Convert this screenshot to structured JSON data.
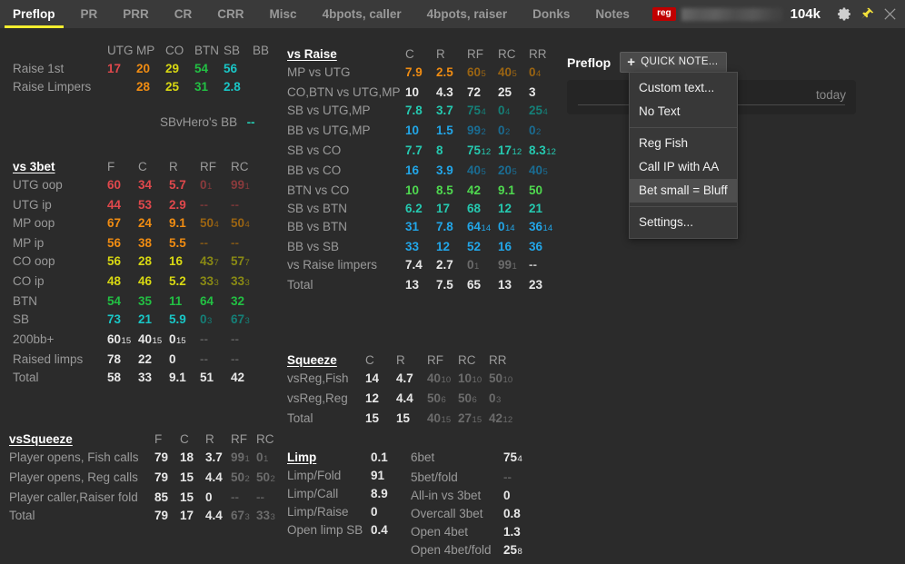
{
  "topbar": {
    "tabs": [
      {
        "label": "Preflop",
        "active": true
      },
      {
        "label": "PR",
        "active": false
      },
      {
        "label": "PRR",
        "active": false
      },
      {
        "label": "CR",
        "active": false
      },
      {
        "label": "CRR",
        "active": false
      },
      {
        "label": "Misc",
        "active": false
      },
      {
        "label": "4bpots, caller",
        "active": false
      },
      {
        "label": "4bpots, raiser",
        "active": false
      },
      {
        "label": "Donks",
        "active": false
      },
      {
        "label": "Notes",
        "active": false
      }
    ],
    "player_badge": "reg",
    "player_name_hidden": "",
    "stack": "104k",
    "gear_icon": "gear-icon",
    "pin_icon": "pin-icon",
    "close_icon": "close-icon",
    "accent": "#f5ee2e",
    "badge_color": "#c00000"
  },
  "raise_first": {
    "headers": [
      "UTG",
      "MP",
      "CO",
      "BTN",
      "SB",
      "BB"
    ],
    "rows": [
      {
        "label": "Raise 1st",
        "values": [
          "17",
          "20",
          "29",
          "54",
          "56",
          ""
        ]
      },
      {
        "label": "Raise Limpers",
        "values": [
          "",
          "28",
          "25",
          "31",
          "2.8",
          ""
        ]
      }
    ],
    "sb_vs_hero": {
      "label": "SBvHero's BB",
      "value": "--"
    }
  },
  "vs3bet": {
    "title": "vs 3bet",
    "headers": [
      "F",
      "C",
      "R",
      "RF",
      "RC"
    ],
    "rows": [
      {
        "label": "UTG oop",
        "values": [
          "60",
          "34",
          "5.7",
          "0",
          "99"
        ],
        "subs": [
          "",
          "",
          "",
          "1",
          "1"
        ]
      },
      {
        "label": "UTG ip",
        "values": [
          "44",
          "53",
          "2.9",
          "--",
          "--"
        ],
        "subs": [
          "",
          "",
          "",
          "",
          ""
        ]
      },
      {
        "label": "MP oop",
        "values": [
          "67",
          "24",
          "9.1",
          "50",
          "50"
        ],
        "subs": [
          "",
          "",
          "",
          "4",
          "4"
        ]
      },
      {
        "label": "MP ip",
        "values": [
          "56",
          "38",
          "5.5",
          "--",
          "--"
        ],
        "subs": [
          "",
          "",
          "",
          "",
          ""
        ]
      },
      {
        "label": "CO oop",
        "values": [
          "56",
          "28",
          "16",
          "43",
          "57"
        ],
        "subs": [
          "",
          "",
          "",
          "7",
          "7"
        ]
      },
      {
        "label": "CO ip",
        "values": [
          "48",
          "46",
          "5.2",
          "33",
          "33"
        ],
        "subs": [
          "",
          "",
          "",
          "3",
          "3"
        ]
      },
      {
        "label": "BTN",
        "values": [
          "54",
          "35",
          "11",
          "64",
          "32"
        ],
        "subs": [
          "",
          "",
          "",
          "",
          ""
        ]
      },
      {
        "label": "SB",
        "values": [
          "73",
          "21",
          "5.9",
          "0",
          "67"
        ],
        "subs": [
          "",
          "",
          "",
          "3",
          "3"
        ]
      },
      {
        "label": "200bb+",
        "values": [
          "60",
          "40",
          "0",
          "--",
          "--"
        ],
        "subs": [
          "15",
          "15",
          "15",
          "",
          ""
        ]
      },
      {
        "label": "Raised limps",
        "values": [
          "78",
          "22",
          "0",
          "--",
          "--"
        ],
        "subs": [
          "",
          "",
          "",
          "",
          ""
        ]
      },
      {
        "label": "Total",
        "values": [
          "58",
          "33",
          "9.1",
          "51",
          "42"
        ],
        "subs": [
          "",
          "",
          "",
          "",
          ""
        ]
      }
    ]
  },
  "vssqueeze": {
    "title": "vsSqueeze",
    "headers": [
      "F",
      "C",
      "R",
      "RF",
      "RC"
    ],
    "rows": [
      {
        "label": "Player opens, Fish calls",
        "values": [
          "79",
          "18",
          "3.7",
          "99",
          "0"
        ],
        "subs": [
          "",
          "",
          "",
          "1",
          "1"
        ]
      },
      {
        "label": "Player opens, Reg calls",
        "values": [
          "79",
          "15",
          "4.4",
          "50",
          "50"
        ],
        "subs": [
          "",
          "",
          "",
          "2",
          "2"
        ]
      },
      {
        "label": "Player caller,Raiser fold",
        "values": [
          "85",
          "15",
          "0",
          "--",
          "--"
        ],
        "subs": [
          "",
          "",
          "",
          "",
          ""
        ]
      },
      {
        "label": "Total",
        "values": [
          "79",
          "17",
          "4.4",
          "67",
          "33"
        ],
        "subs": [
          "",
          "",
          "",
          "3",
          "3"
        ]
      }
    ]
  },
  "vsraise": {
    "title": "vs Raise",
    "headers": [
      "C",
      "R",
      "RF",
      "RC",
      "RR"
    ],
    "rows": [
      {
        "label": "MP vs UTG",
        "values": [
          "7.9",
          "2.5",
          "60",
          "40",
          "0"
        ],
        "subs": [
          "",
          "",
          "5",
          "5",
          "4"
        ]
      },
      {
        "label": "CO,BTN vs UTG,MP",
        "values": [
          "10",
          "4.3",
          "72",
          "25",
          "3"
        ],
        "subs": [
          "",
          "",
          "",
          "",
          ""
        ]
      },
      {
        "label": "SB vs UTG,MP",
        "values": [
          "7.8",
          "3.7",
          "75",
          "0",
          "25"
        ],
        "subs": [
          "",
          "",
          "4",
          "4",
          "4"
        ]
      },
      {
        "label": "BB vs UTG,MP",
        "values": [
          "10",
          "1.5",
          "99",
          "0",
          "0"
        ],
        "subs": [
          "",
          "",
          "2",
          "2",
          "2"
        ]
      },
      {
        "label": "SB vs CO",
        "values": [
          "7.7",
          "8",
          "75",
          "17",
          "8.3"
        ],
        "subs": [
          "",
          "",
          "12",
          "12",
          "12"
        ]
      },
      {
        "label": "BB vs CO",
        "values": [
          "16",
          "3.9",
          "40",
          "20",
          "40"
        ],
        "subs": [
          "",
          "",
          "5",
          "5",
          "5"
        ]
      },
      {
        "label": "BTN vs CO",
        "values": [
          "10",
          "8.5",
          "42",
          "9.1",
          "50"
        ],
        "subs": [
          "",
          "",
          "",
          "",
          ""
        ]
      },
      {
        "label": "SB vs BTN",
        "values": [
          "6.2",
          "17",
          "68",
          "12",
          "21"
        ],
        "subs": [
          "",
          "",
          "",
          "",
          ""
        ]
      },
      {
        "label": "BB vs BTN",
        "values": [
          "31",
          "7.8",
          "64",
          "0",
          "36"
        ],
        "subs": [
          "",
          "",
          "14",
          "14",
          "14"
        ]
      },
      {
        "label": "BB vs SB",
        "values": [
          "33",
          "12",
          "52",
          "16",
          "36"
        ],
        "subs": [
          "",
          "",
          "",
          "",
          ""
        ]
      },
      {
        "label": "vs Raise limpers",
        "values": [
          "7.4",
          "2.7",
          "0",
          "99",
          "--"
        ],
        "subs": [
          "",
          "",
          "1",
          "1",
          ""
        ]
      },
      {
        "label": "Total",
        "values": [
          "13",
          "7.5",
          "65",
          "13",
          "23"
        ],
        "subs": [
          "",
          "",
          "",
          "",
          ""
        ]
      }
    ]
  },
  "squeeze": {
    "title": "Squeeze",
    "headers": [
      "C",
      "R",
      "RF",
      "RC",
      "RR"
    ],
    "rows": [
      {
        "label": "vsReg,Fish",
        "values": [
          "14",
          "4.7",
          "40",
          "10",
          "50"
        ],
        "subs": [
          "",
          "",
          "10",
          "10",
          "10"
        ]
      },
      {
        "label": "vsReg,Reg",
        "values": [
          "12",
          "4.4",
          "50",
          "50",
          "0"
        ],
        "subs": [
          "",
          "",
          "6",
          "6",
          "3"
        ]
      },
      {
        "label": "Total",
        "values": [
          "15",
          "15",
          "40",
          "27",
          "42"
        ],
        "subs": [
          "",
          "",
          "15",
          "15",
          "12"
        ]
      }
    ]
  },
  "limp": {
    "title": "Limp",
    "title_value": "0.1",
    "rows": [
      {
        "label": "Limp/Fold",
        "value": "91",
        "sub": ""
      },
      {
        "label": "Limp/Call",
        "value": "8.9",
        "sub": ""
      },
      {
        "label": "Limp/Raise",
        "value": "0",
        "sub": ""
      },
      {
        "label": "Open limp SB",
        "value": "0.4",
        "sub": ""
      }
    ]
  },
  "misc": {
    "rows": [
      {
        "label": "6bet",
        "value": "75",
        "sub": "4"
      },
      {
        "label": "5bet/fold",
        "value": "--",
        "sub": ""
      },
      {
        "label": "All-in vs 3bet",
        "value": "0",
        "sub": ""
      },
      {
        "label": "Overcall 3bet",
        "value": "0.8",
        "sub": ""
      },
      {
        "label": "Open 4bet",
        "value": "1.3",
        "sub": ""
      },
      {
        "label": "Open 4bet/fold",
        "value": "25",
        "sub": "8"
      }
    ]
  },
  "note_panel": {
    "title": "Preflop",
    "quick_note_label": "QUICK NOTE...",
    "plus_icon": "plus-icon",
    "input_value": "",
    "date_label": "today"
  },
  "quick_note_menu": {
    "items": [
      {
        "label": "Custom text...",
        "selected": false,
        "sep_after": false
      },
      {
        "label": "No Text",
        "selected": false,
        "sep_after": true
      },
      {
        "label": "Reg Fish",
        "selected": false,
        "sep_after": false
      },
      {
        "label": "Call IP with AA",
        "selected": false,
        "sep_after": false
      },
      {
        "label": "Bet small = Bluff",
        "selected": true,
        "sep_after": true
      },
      {
        "label": "Settings...",
        "selected": false,
        "sep_after": false
      }
    ]
  }
}
